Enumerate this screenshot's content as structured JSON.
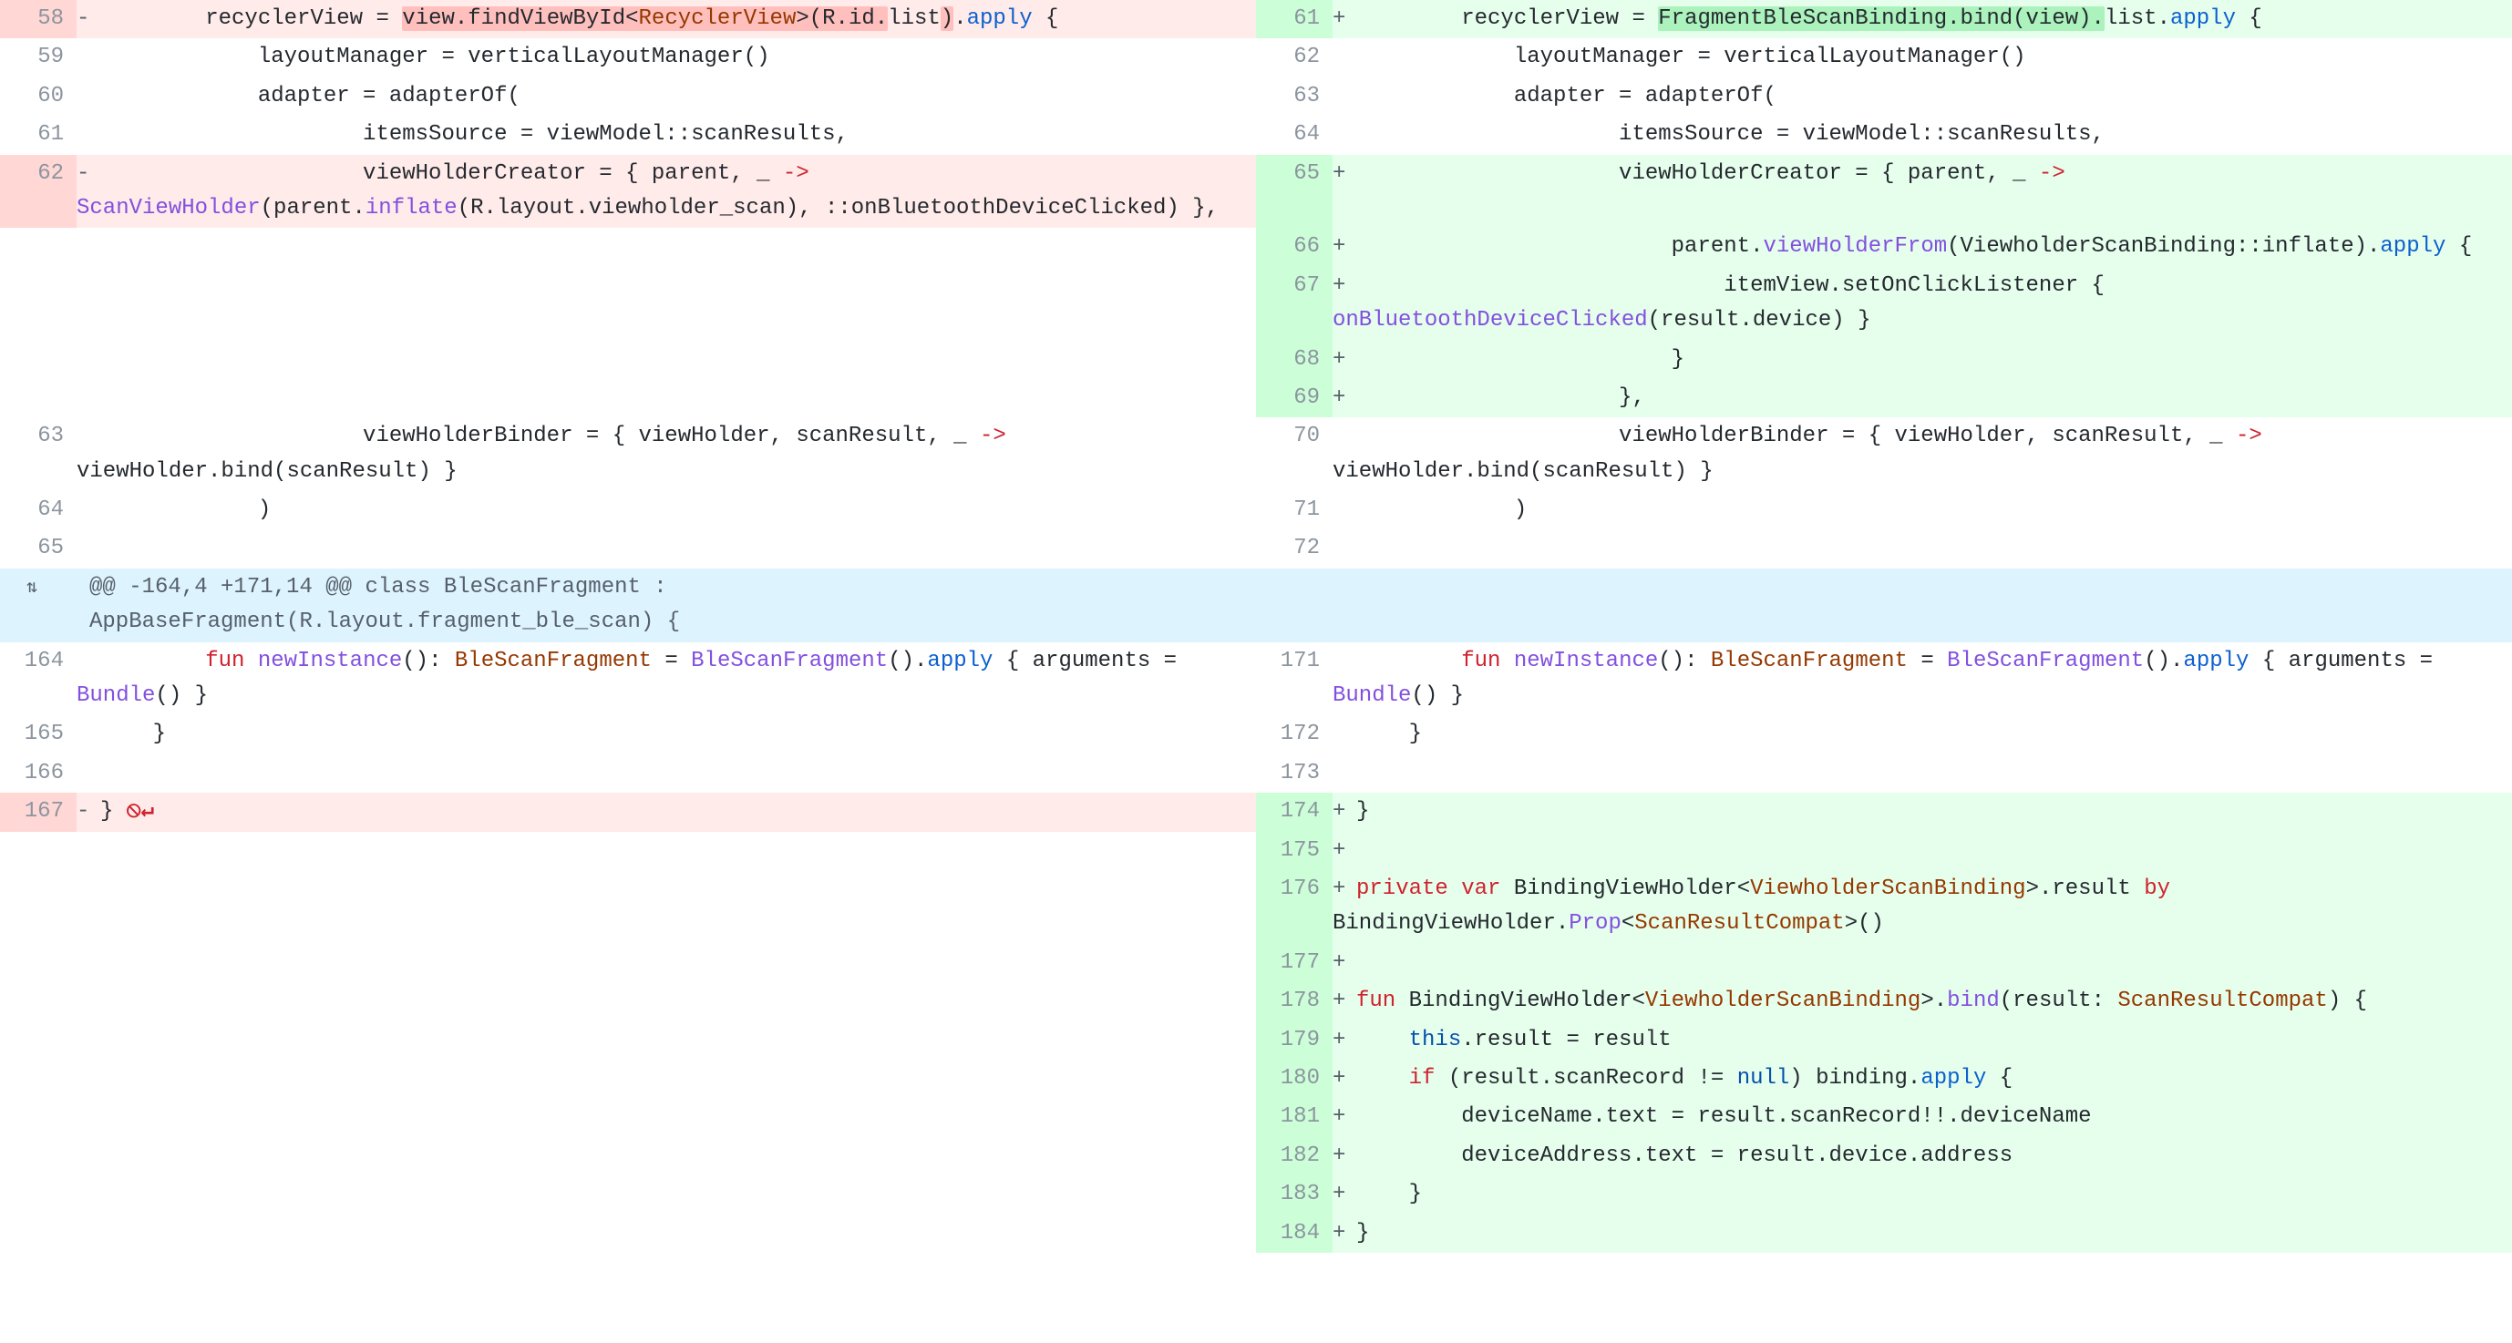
{
  "hunk_header": "@@ -164,4 +171,14 @@ class BleScanFragment : AppBaseFragment(R.layout.fragment_ble_scan) {",
  "expand_glyph": "⇅",
  "no_newline_glyph": "⦸↵",
  "left": {
    "lines": {
      "l58": "58",
      "l59": "59",
      "l60": "60",
      "l61": "61",
      "l62": "62",
      "l63": "63",
      "l64": "64",
      "l65": "65",
      "l164": "164",
      "l165": "165",
      "l166": "166",
      "l167": "167"
    },
    "code": {
      "r58_pre": "        recyclerView = ",
      "r58_hl1": "view.findViewById<",
      "r58_hl_type": "RecyclerView",
      "r58_hl2": ">(R.id.",
      "r58_mid": "list",
      "r58_hl3": ")",
      "r58_dot": ".",
      "r58_apply": "apply",
      "r58_brace": " {",
      "r59": "            layoutManager = verticalLayoutManager()",
      "r60": "            adapter = adapterOf(",
      "r61": "                    itemsSource = viewModel::scanResults,",
      "r62_a": "                    viewHolderCreator = { parent, _ ",
      "r62_arrow": "->",
      "r62_b1": " ",
      "r62_fn1": "ScanViewHolder",
      "r62_b2": "(parent.",
      "r62_fn2": "inflate",
      "r62_b3": "(R.layout.viewholder_scan), ::onBluetoothDeviceClicked) },",
      "r63_a": "                    viewHolderBinder = { viewHolder, scanResult, _ ",
      "r63_arrow": "->",
      "r63_b": " viewHolder.bind(scanResult) }",
      "r64": "            )",
      "r65": "",
      "r164_a": "        ",
      "r164_kw": "fun",
      "r164_b": " ",
      "r164_fn": "newInstance",
      "r164_c": "(): ",
      "r164_ty": "BleScanFragment",
      "r164_d": " = ",
      "r164_fn2": "BleScanFragment",
      "r164_e": "().",
      "r164_ap": "apply",
      "r164_f": " { arguments = ",
      "r164_fn3": "Bundle",
      "r164_g": "() }",
      "r165": "    }",
      "r166": "",
      "r167": "}"
    }
  },
  "right": {
    "lines": {
      "l61": "61",
      "l62": "62",
      "l63": "63",
      "l64": "64",
      "l65": "65",
      "l66": "66",
      "l67": "67",
      "l68": "68",
      "l69": "69",
      "l70": "70",
      "l71": "71",
      "l72": "72",
      "l171": "171",
      "l172": "172",
      "l173": "173",
      "l174": "174",
      "l175": "175",
      "l176": "176",
      "l177": "177",
      "l178": "178",
      "l179": "179",
      "l180": "180",
      "l181": "181",
      "l182": "182",
      "l183": "183",
      "l184": "184"
    },
    "code": {
      "r61_pre": "        recyclerView = ",
      "r61_hl1": "FragmentBleScanBinding.bind(view).",
      "r61_mid": "list",
      "r61_dot": ".",
      "r61_apply": "apply",
      "r61_brace": " {",
      "r62": "            layoutManager = verticalLayoutManager()",
      "r63": "            adapter = adapterOf(",
      "r64": "                    itemsSource = viewModel::scanResults,",
      "r65_a": "                    viewHolderCreator = { parent, _ ",
      "r65_arrow": "->",
      "r66_a": "                        parent.",
      "r66_fn": "viewHolderFrom",
      "r66_b": "(ViewholderScanBinding::inflate).",
      "r66_ap": "apply",
      "r66_c": " {",
      "r67_a": "                            itemView.setOnClickListener { ",
      "r67_fn": "onBluetoothDeviceClicked",
      "r67_b": "(result.device) }",
      "r68": "                        }",
      "r69": "                    },",
      "r70_a": "                    viewHolderBinder = { viewHolder, scanResult, _ ",
      "r70_arrow": "->",
      "r70_b": " viewHolder.bind(scanResult) }",
      "r71": "            )",
      "r72": "",
      "r171_a": "        ",
      "r171_kw": "fun",
      "r171_b": " ",
      "r171_fn": "newInstance",
      "r171_c": "(): ",
      "r171_ty": "BleScanFragment",
      "r171_d": " = ",
      "r171_fn2": "BleScanFragment",
      "r171_e": "().",
      "r171_ap": "apply",
      "r171_f": " { arguments = ",
      "r171_fn3": "Bundle",
      "r171_g": "() }",
      "r172": "    }",
      "r173": "",
      "r174": "}",
      "r175": "",
      "r176_kw1": "private",
      "r176_sp1": " ",
      "r176_kw2": "var",
      "r176_a": " BindingViewHolder<",
      "r176_ty1": "ViewholderScanBinding",
      "r176_b": ">.result ",
      "r176_kw3": "by",
      "r176_c": " BindingViewHolder.",
      "r176_fn": "Prop",
      "r176_d": "<",
      "r176_ty2": "ScanResultCompat",
      "r176_e": ">()",
      "r177": "",
      "r178_kw": "fun",
      "r178_a": " BindingViewHolder<",
      "r178_ty1": "ViewholderScanBinding",
      "r178_b": ">.",
      "r178_fn": "bind",
      "r178_c": "(result: ",
      "r178_ty2": "ScanResultCompat",
      "r178_d": ") {",
      "r179_a": "    ",
      "r179_this": "this",
      "r179_b": ".result = result",
      "r180_a": "    ",
      "r180_kw": "if",
      "r180_b": " (result.scanRecord != ",
      "r180_null": "null",
      "r180_c": ") binding.",
      "r180_ap": "apply",
      "r180_d": " {",
      "r181": "        deviceName.text = result.scanRecord!!.deviceName",
      "r182": "        deviceAddress.text = result.device.address",
      "r183": "    }",
      "r184": "}"
    }
  }
}
